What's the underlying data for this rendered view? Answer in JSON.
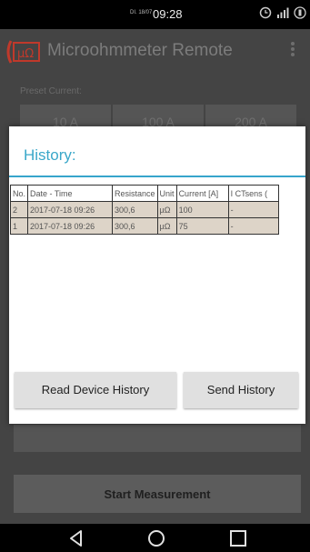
{
  "status": {
    "date": "DI. 18/07",
    "time": "09:28"
  },
  "app": {
    "logo_text": "µΩ",
    "title": "Microohmmeter Remote"
  },
  "background": {
    "preset_label": "Preset Current:",
    "preset_buttons": [
      "10 A",
      "100 A",
      "200 A"
    ],
    "start_label": "Start Measurement"
  },
  "dialog": {
    "title": "History:",
    "columns": [
      "No.",
      "Date - Time",
      "Resistance",
      "Unit",
      "Current [A]",
      "I CTsens ("
    ],
    "rows": [
      [
        "2",
        "2017-07-18 09:26",
        "300,6",
        "µΩ",
        "100",
        "-"
      ],
      [
        "1",
        "2017-07-18 09:26",
        "300,6",
        "µΩ",
        "75",
        "-"
      ]
    ],
    "read_button": "Read Device History",
    "send_button": "Send History"
  },
  "icons": {
    "status": [
      "alarm-icon",
      "signal-icon",
      "battery-icon"
    ],
    "nav": [
      "back-icon",
      "home-icon",
      "recents-icon"
    ]
  },
  "colors": {
    "accent": "#37a5cc",
    "logo_red": "#c0392b",
    "row_bg": "#ddd4c8"
  }
}
